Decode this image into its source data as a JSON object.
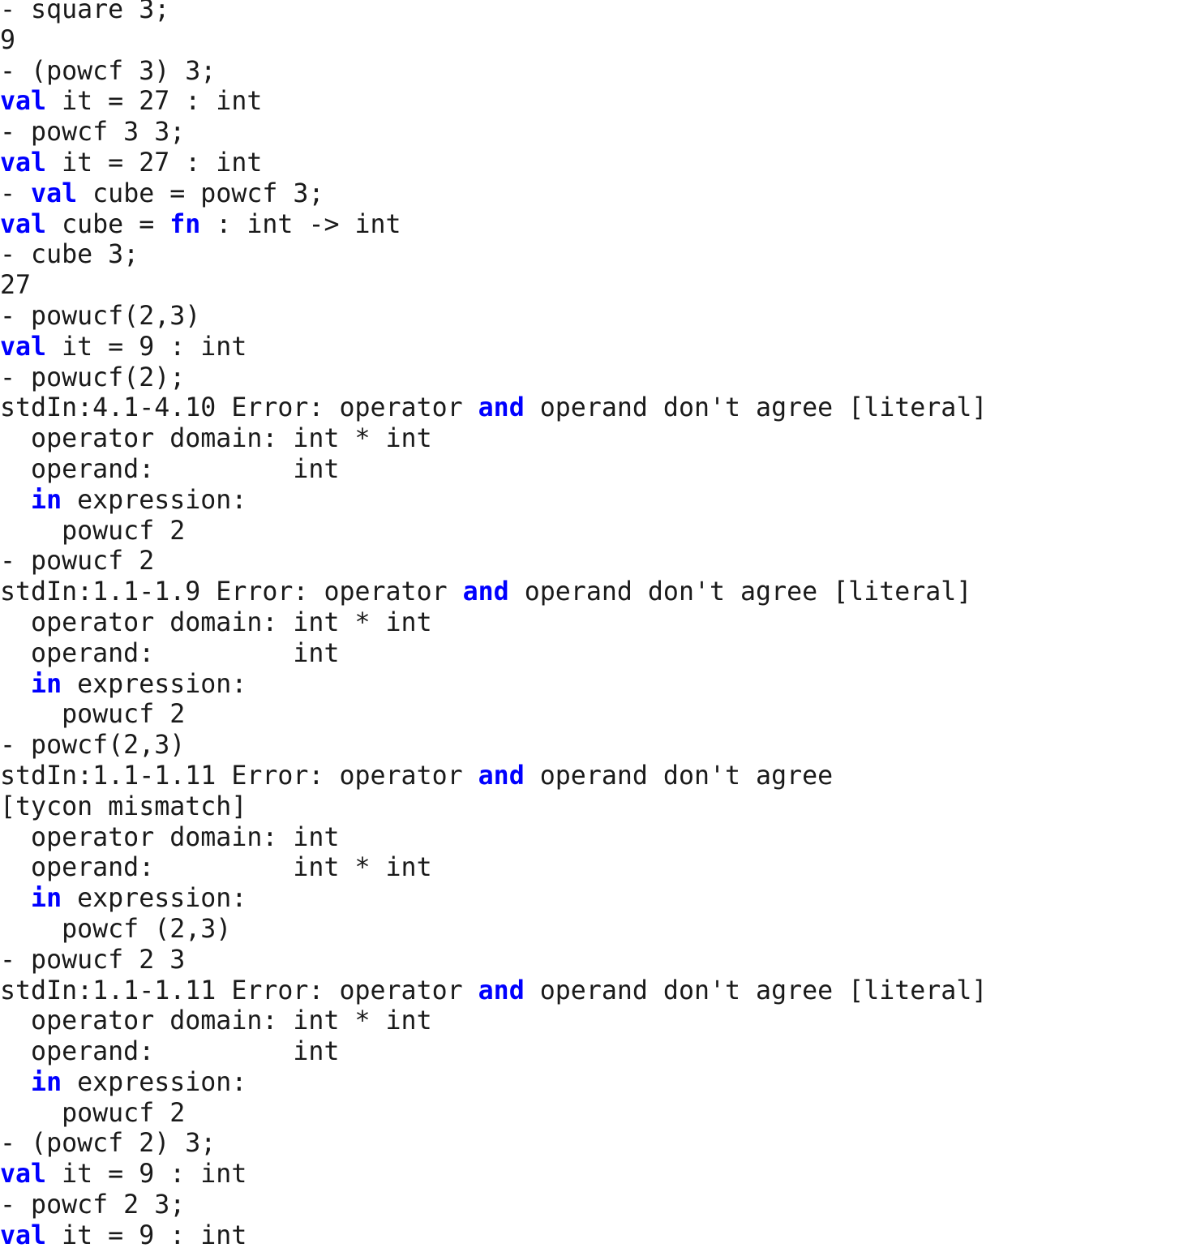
{
  "terminal": {
    "app": "SML/NJ interactive REPL",
    "prompt": "-",
    "colors": {
      "background": "#ffffff",
      "text": "#1a1a1a",
      "keyword": "#0000ff"
    },
    "keywords": [
      "val",
      "fn",
      "and",
      "in"
    ],
    "lines": [
      {
        "id": "line-01",
        "kind": "input",
        "segments": [
          {
            "text": "- square 3;"
          }
        ]
      },
      {
        "id": "line-02",
        "kind": "output",
        "segments": [
          {
            "text": "9"
          }
        ]
      },
      {
        "id": "line-03",
        "kind": "input",
        "segments": [
          {
            "text": "- (powcf 3) 3;"
          }
        ]
      },
      {
        "id": "line-04",
        "kind": "output",
        "segments": [
          {
            "text": "val",
            "style": "kw"
          },
          {
            "text": " it = 27 : int"
          }
        ]
      },
      {
        "id": "line-05",
        "kind": "input",
        "segments": [
          {
            "text": "- powcf 3 3;"
          }
        ]
      },
      {
        "id": "line-06",
        "kind": "output",
        "segments": [
          {
            "text": "val",
            "style": "kw"
          },
          {
            "text": " it = 27 : int"
          }
        ]
      },
      {
        "id": "line-07",
        "kind": "input",
        "segments": [
          {
            "text": "- "
          },
          {
            "text": "val",
            "style": "kw"
          },
          {
            "text": " cube = powcf 3;"
          }
        ]
      },
      {
        "id": "line-08",
        "kind": "output",
        "segments": [
          {
            "text": "val",
            "style": "kw"
          },
          {
            "text": " cube = "
          },
          {
            "text": "fn",
            "style": "kw"
          },
          {
            "text": " : int -> int"
          }
        ]
      },
      {
        "id": "line-09",
        "kind": "input",
        "segments": [
          {
            "text": "- cube 3;"
          }
        ]
      },
      {
        "id": "line-10",
        "kind": "output",
        "segments": [
          {
            "text": "27"
          }
        ]
      },
      {
        "id": "line-11",
        "kind": "input",
        "segments": [
          {
            "text": "- powucf(2,3)"
          }
        ]
      },
      {
        "id": "line-12",
        "kind": "output",
        "segments": [
          {
            "text": "val",
            "style": "kw"
          },
          {
            "text": " it = 9 : int"
          }
        ]
      },
      {
        "id": "line-13",
        "kind": "input",
        "segments": [
          {
            "text": "- powucf(2);"
          }
        ]
      },
      {
        "id": "line-14",
        "kind": "error",
        "segments": [
          {
            "text": "stdIn:4.1-4.10 Error: operator "
          },
          {
            "text": "and",
            "style": "kw"
          },
          {
            "text": " operand don't agree [literal]"
          }
        ]
      },
      {
        "id": "line-15",
        "kind": "error",
        "segments": [
          {
            "text": "  operator domain: int * int"
          }
        ]
      },
      {
        "id": "line-16",
        "kind": "error",
        "segments": [
          {
            "text": "  operand:         int"
          }
        ]
      },
      {
        "id": "line-17",
        "kind": "error",
        "segments": [
          {
            "text": "  "
          },
          {
            "text": "in",
            "style": "kw"
          },
          {
            "text": " expression:"
          }
        ]
      },
      {
        "id": "line-18",
        "kind": "error",
        "segments": [
          {
            "text": "    powucf 2"
          }
        ]
      },
      {
        "id": "line-19",
        "kind": "input",
        "segments": [
          {
            "text": "- powucf 2"
          }
        ]
      },
      {
        "id": "line-20",
        "kind": "error",
        "segments": [
          {
            "text": "stdIn:1.1-1.9 Error: operator "
          },
          {
            "text": "and",
            "style": "kw"
          },
          {
            "text": " operand don't agree [literal]"
          }
        ]
      },
      {
        "id": "line-21",
        "kind": "error",
        "segments": [
          {
            "text": "  operator domain: int * int"
          }
        ]
      },
      {
        "id": "line-22",
        "kind": "error",
        "segments": [
          {
            "text": "  operand:         int"
          }
        ]
      },
      {
        "id": "line-23",
        "kind": "error",
        "segments": [
          {
            "text": "  "
          },
          {
            "text": "in",
            "style": "kw"
          },
          {
            "text": " expression:"
          }
        ]
      },
      {
        "id": "line-24",
        "kind": "error",
        "segments": [
          {
            "text": "    powucf 2"
          }
        ]
      },
      {
        "id": "line-25",
        "kind": "input",
        "segments": [
          {
            "text": "- powcf(2,3)"
          }
        ]
      },
      {
        "id": "line-26",
        "kind": "error",
        "segments": [
          {
            "text": "stdIn:1.1-1.11 Error: operator "
          },
          {
            "text": "and",
            "style": "kw"
          },
          {
            "text": " operand don't agree"
          }
        ]
      },
      {
        "id": "line-27",
        "kind": "error",
        "segments": [
          {
            "text": "[tycon mismatch]"
          }
        ]
      },
      {
        "id": "line-28",
        "kind": "error",
        "segments": [
          {
            "text": "  operator domain: int"
          }
        ]
      },
      {
        "id": "line-29",
        "kind": "error",
        "segments": [
          {
            "text": "  operand:         int * int"
          }
        ]
      },
      {
        "id": "line-30",
        "kind": "error",
        "segments": [
          {
            "text": "  "
          },
          {
            "text": "in",
            "style": "kw"
          },
          {
            "text": " expression:"
          }
        ]
      },
      {
        "id": "line-31",
        "kind": "error",
        "segments": [
          {
            "text": "    powcf (2,3)"
          }
        ]
      },
      {
        "id": "line-32",
        "kind": "input",
        "segments": [
          {
            "text": "- powucf 2 3"
          }
        ]
      },
      {
        "id": "line-33",
        "kind": "error",
        "segments": [
          {
            "text": "stdIn:1.1-1.11 Error: operator "
          },
          {
            "text": "and",
            "style": "kw"
          },
          {
            "text": " operand don't agree [literal]"
          }
        ]
      },
      {
        "id": "line-34",
        "kind": "error",
        "segments": [
          {
            "text": "  operator domain: int * int"
          }
        ]
      },
      {
        "id": "line-35",
        "kind": "error",
        "segments": [
          {
            "text": "  operand:         int"
          }
        ]
      },
      {
        "id": "line-36",
        "kind": "error",
        "segments": [
          {
            "text": "  "
          },
          {
            "text": "in",
            "style": "kw"
          },
          {
            "text": " expression:"
          }
        ]
      },
      {
        "id": "line-37",
        "kind": "error",
        "segments": [
          {
            "text": "    powucf 2"
          }
        ]
      },
      {
        "id": "line-38",
        "kind": "input",
        "segments": [
          {
            "text": "- (powcf 2) 3;"
          }
        ]
      },
      {
        "id": "line-39",
        "kind": "output",
        "segments": [
          {
            "text": "val",
            "style": "kw"
          },
          {
            "text": " it = 9 : int"
          }
        ]
      },
      {
        "id": "line-40",
        "kind": "input",
        "segments": [
          {
            "text": "- powcf 2 3;"
          }
        ]
      },
      {
        "id": "line-41",
        "kind": "output",
        "segments": [
          {
            "text": "val",
            "style": "kw"
          },
          {
            "text": " it = 9 : int"
          }
        ]
      }
    ]
  }
}
